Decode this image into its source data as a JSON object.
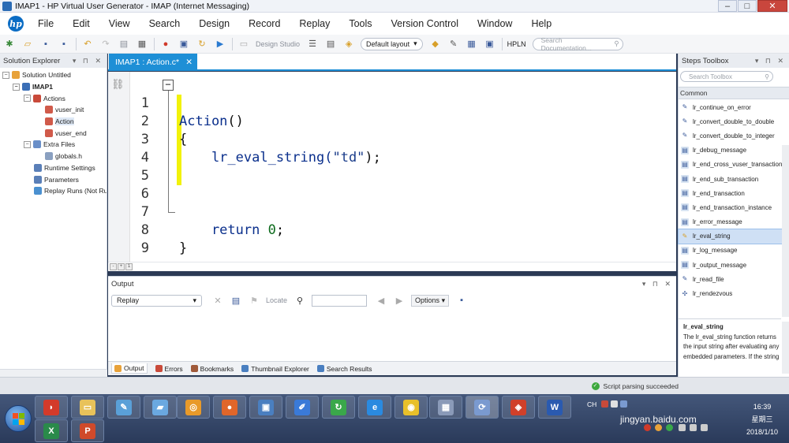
{
  "window": {
    "title": "IMAP1 - HP Virtual User Generator - IMAP (Internet Messaging)",
    "controls": {
      "minimize": "–",
      "maximize": "□",
      "close": "✕"
    }
  },
  "menu": {
    "logo": "hp",
    "items": [
      "File",
      "Edit",
      "View",
      "Search",
      "Design",
      "Record",
      "Replay",
      "Tools",
      "Version Control",
      "Window",
      "Help"
    ]
  },
  "toolbar": {
    "design_studio": "Design Studio",
    "layout": "Default layout",
    "hpln": "HPLN",
    "search_placeholder": "Search Documentation..."
  },
  "solution_explorer": {
    "title": "Solution Explorer",
    "header_buttons": "▾ ⊓ ✕",
    "items": [
      {
        "label": "Solution Untitled",
        "icon": "solution-icon",
        "color": "#e8a23a"
      },
      {
        "label": "IMAP1",
        "icon": "script-icon",
        "color": "#3b6fb6"
      },
      {
        "label": "Actions",
        "icon": "actions-icon",
        "color": "#c94a3a"
      },
      {
        "label": "vuser_init",
        "icon": "action-icon",
        "color": "#d05a4a"
      },
      {
        "label": "Action",
        "icon": "action-icon",
        "color": "#d05a4a"
      },
      {
        "label": "vuser_end",
        "icon": "action-icon",
        "color": "#d05a4a"
      },
      {
        "label": "Extra Files",
        "icon": "folder-icon",
        "color": "#6a8fc8"
      },
      {
        "label": "globals.h",
        "icon": "file-icon",
        "color": "#8aa0c0"
      },
      {
        "label": "Runtime Settings",
        "icon": "settings-icon",
        "color": "#5a7fb8"
      },
      {
        "label": "Parameters",
        "icon": "parameters-icon",
        "color": "#5a7fb8"
      },
      {
        "label": "Replay Runs (Not Run",
        "icon": "replay-icon",
        "color": "#4a90d0"
      }
    ]
  },
  "editor": {
    "tab_label": "IMAP1 : Action.c*",
    "tab_close": "✕",
    "lines": [
      {
        "n": "1",
        "kw": "Action",
        "rest": "()"
      },
      {
        "n": "2",
        "kw": "",
        "rest": "{"
      },
      {
        "n": "3",
        "kw": "",
        "rest": "    lr_eval_string(",
        "str": "\"td\"",
        "end": ");"
      },
      {
        "n": "4",
        "kw": "",
        "rest": ""
      },
      {
        "n": "5",
        "kw": "",
        "rest": ""
      },
      {
        "n": "6",
        "kw": "",
        "rest": ""
      },
      {
        "n": "7",
        "kw": "    return",
        "rest": " ",
        "num": "0",
        "end": ";"
      },
      {
        "n": "8",
        "kw": "",
        "rest": "}"
      },
      {
        "n": "9",
        "kw": "",
        "rest": ""
      }
    ],
    "zoom_labels": [
      "-",
      "+",
      "1"
    ],
    "fold_label": "−"
  },
  "output": {
    "title": "Output",
    "header_buttons": "▾ ⊓ ✕",
    "combo": "Replay",
    "locate": "Locate",
    "options": "Options"
  },
  "bottom_tabs": [
    {
      "label": "Output",
      "color": "#e8a23a"
    },
    {
      "label": "Errors",
      "color": "#c94a3a"
    },
    {
      "label": "Bookmarks",
      "color": "#a05a3a"
    },
    {
      "label": "Thumbnail Explorer",
      "color": "#4a7fc0"
    },
    {
      "label": "Search Results",
      "color": "#4a7fc0"
    }
  ],
  "steps_toolbox": {
    "title": "Steps Toolbox",
    "header_buttons": "▾ ⊓ ✕",
    "search_placeholder": "Search Toolbox",
    "category": "Common",
    "items": [
      "lr_continue_on_error",
      "lr_convert_double_to_double",
      "lr_convert_double_to_integer",
      "lr_debug_message",
      "lr_end_cross_vuser_transaction",
      "lr_end_sub_transaction",
      "lr_end_transaction",
      "lr_end_transaction_instance",
      "lr_error_message",
      "lr_eval_string",
      "lr_log_message",
      "lr_output_message",
      "lr_read_file",
      "lr_rendezvous"
    ],
    "selected_index": 9,
    "description": {
      "title": "lr_eval_string",
      "text": "The lr_eval_string function returns the input string after evaluating any embedded parameters. If the string"
    }
  },
  "statusbar": {
    "text": "Script parsing succeeded"
  },
  "taskbar": {
    "apps": [
      {
        "name": "pdf-reader-icon",
        "glyph": "◗",
        "color": "#d33a2a"
      },
      {
        "name": "file-explorer-icon",
        "glyph": "▭",
        "color": "#e8c25a"
      },
      {
        "name": "paint-icon",
        "glyph": "✎",
        "color": "#5aa0d8"
      },
      {
        "name": "window-icon",
        "glyph": "▰",
        "color": "#6aa8e0"
      },
      {
        "name": "search-tool-icon",
        "glyph": "◎",
        "color": "#e89a2a"
      },
      {
        "name": "firefox-icon",
        "glyph": "●",
        "color": "#e0662a"
      },
      {
        "name": "remote-desktop-icon",
        "glyph": "▣",
        "color": "#4a7fc0"
      },
      {
        "name": "pen-tool-icon",
        "glyph": "✐",
        "color": "#3a7ad8"
      },
      {
        "name": "update-icon",
        "glyph": "↻",
        "color": "#3aa84a"
      },
      {
        "name": "ie-icon",
        "glyph": "e",
        "color": "#2a8ae0"
      },
      {
        "name": "chrome-icon",
        "glyph": "◉",
        "color": "#e8c02a"
      },
      {
        "name": "calculator-icon",
        "glyph": "▦",
        "color": "#8a9ab8"
      },
      {
        "name": "vugen-icon",
        "glyph": "⟳",
        "color": "#7a9ad0"
      },
      {
        "name": "vmware-icon",
        "glyph": "◈",
        "color": "#d0402a"
      },
      {
        "name": "word-icon",
        "glyph": "W",
        "color": "#2a5ab0"
      },
      {
        "name": "excel-icon",
        "glyph": "X",
        "color": "#2a8a4a"
      },
      {
        "name": "powerpoint-icon",
        "glyph": "P",
        "color": "#d04a2a"
      }
    ],
    "lang": "CH",
    "time": "16:39",
    "weekday": "星期三",
    "date": "2018/1/10",
    "watermark_domain": "jingyan.baidu.com"
  }
}
